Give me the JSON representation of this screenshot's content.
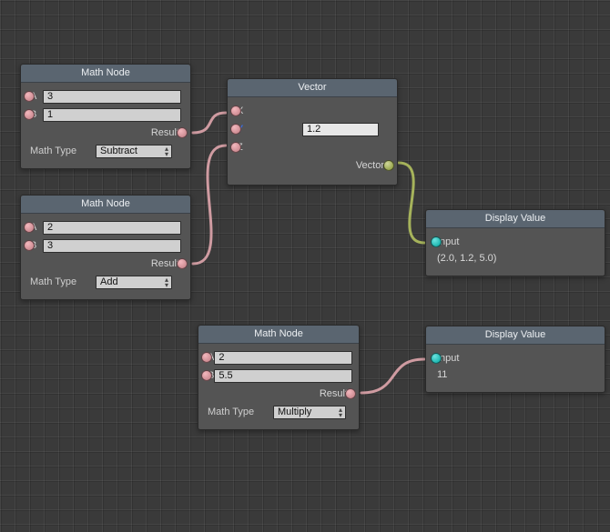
{
  "nodes": {
    "math1": {
      "title": "Math Node",
      "a_label": "A",
      "a_value": "3",
      "b_label": "B",
      "b_value": "1",
      "result_label": "Result",
      "mathtype_label": "Math Type",
      "mathtype_value": "Subtract"
    },
    "math2": {
      "title": "Math Node",
      "a_label": "A",
      "a_value": "2",
      "b_label": "B",
      "b_value": "3",
      "result_label": "Result",
      "mathtype_label": "Math Type",
      "mathtype_value": "Add"
    },
    "math3": {
      "title": "Math Node",
      "a_label": "A",
      "a_value": "2",
      "b_label": "B",
      "b_value": "5.5",
      "result_label": "Result",
      "mathtype_label": "Math Type",
      "mathtype_value": "Multiply"
    },
    "vector": {
      "title": "Vector",
      "x_label": "X",
      "y_label": "Y",
      "y_value": "1.2",
      "z_label": "Z",
      "out_label": "Vector"
    },
    "display1": {
      "title": "Display Value",
      "input_label": "Input",
      "value": "(2.0, 1.2, 5.0)"
    },
    "display2": {
      "title": "Display Value",
      "input_label": "Input",
      "value": "11"
    }
  },
  "colors": {
    "pink": "#cf8d94",
    "olive": "#9aa84f",
    "teal": "#1fb7b1"
  },
  "connections": [
    {
      "from": "math1.result",
      "to": "vector.x",
      "color": "pink"
    },
    {
      "from": "math2.result",
      "to": "vector.z",
      "color": "pink"
    },
    {
      "from": "vector.out",
      "to": "display1.input",
      "color": "olive"
    },
    {
      "from": "math3.result",
      "to": "display2.input",
      "color": "pink"
    }
  ]
}
